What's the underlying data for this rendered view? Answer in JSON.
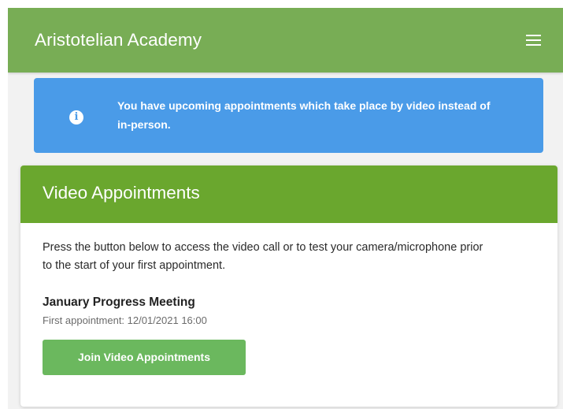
{
  "header": {
    "title": "Aristotelian Academy",
    "menu_icon": "hamburger-menu-icon"
  },
  "alert": {
    "icon": "info-icon",
    "icon_glyph": "i",
    "message": "You have upcoming appointments which take place by video instead of in-person."
  },
  "card": {
    "title": "Video Appointments",
    "description": "Press the button below to access the video call or to test your camera/microphone prior to the start of your first appointment.",
    "meeting_name": "January Progress Meeting",
    "first_appointment": "First appointment: 12/01/2021 16:00",
    "join_button_label": "Join Video Appointments"
  },
  "colors": {
    "navbar": "#78ad55",
    "alert": "#4a9be8",
    "card_header": "#6aa72e",
    "join_button": "#6bb85e",
    "page_background": "#f2f2f2"
  }
}
